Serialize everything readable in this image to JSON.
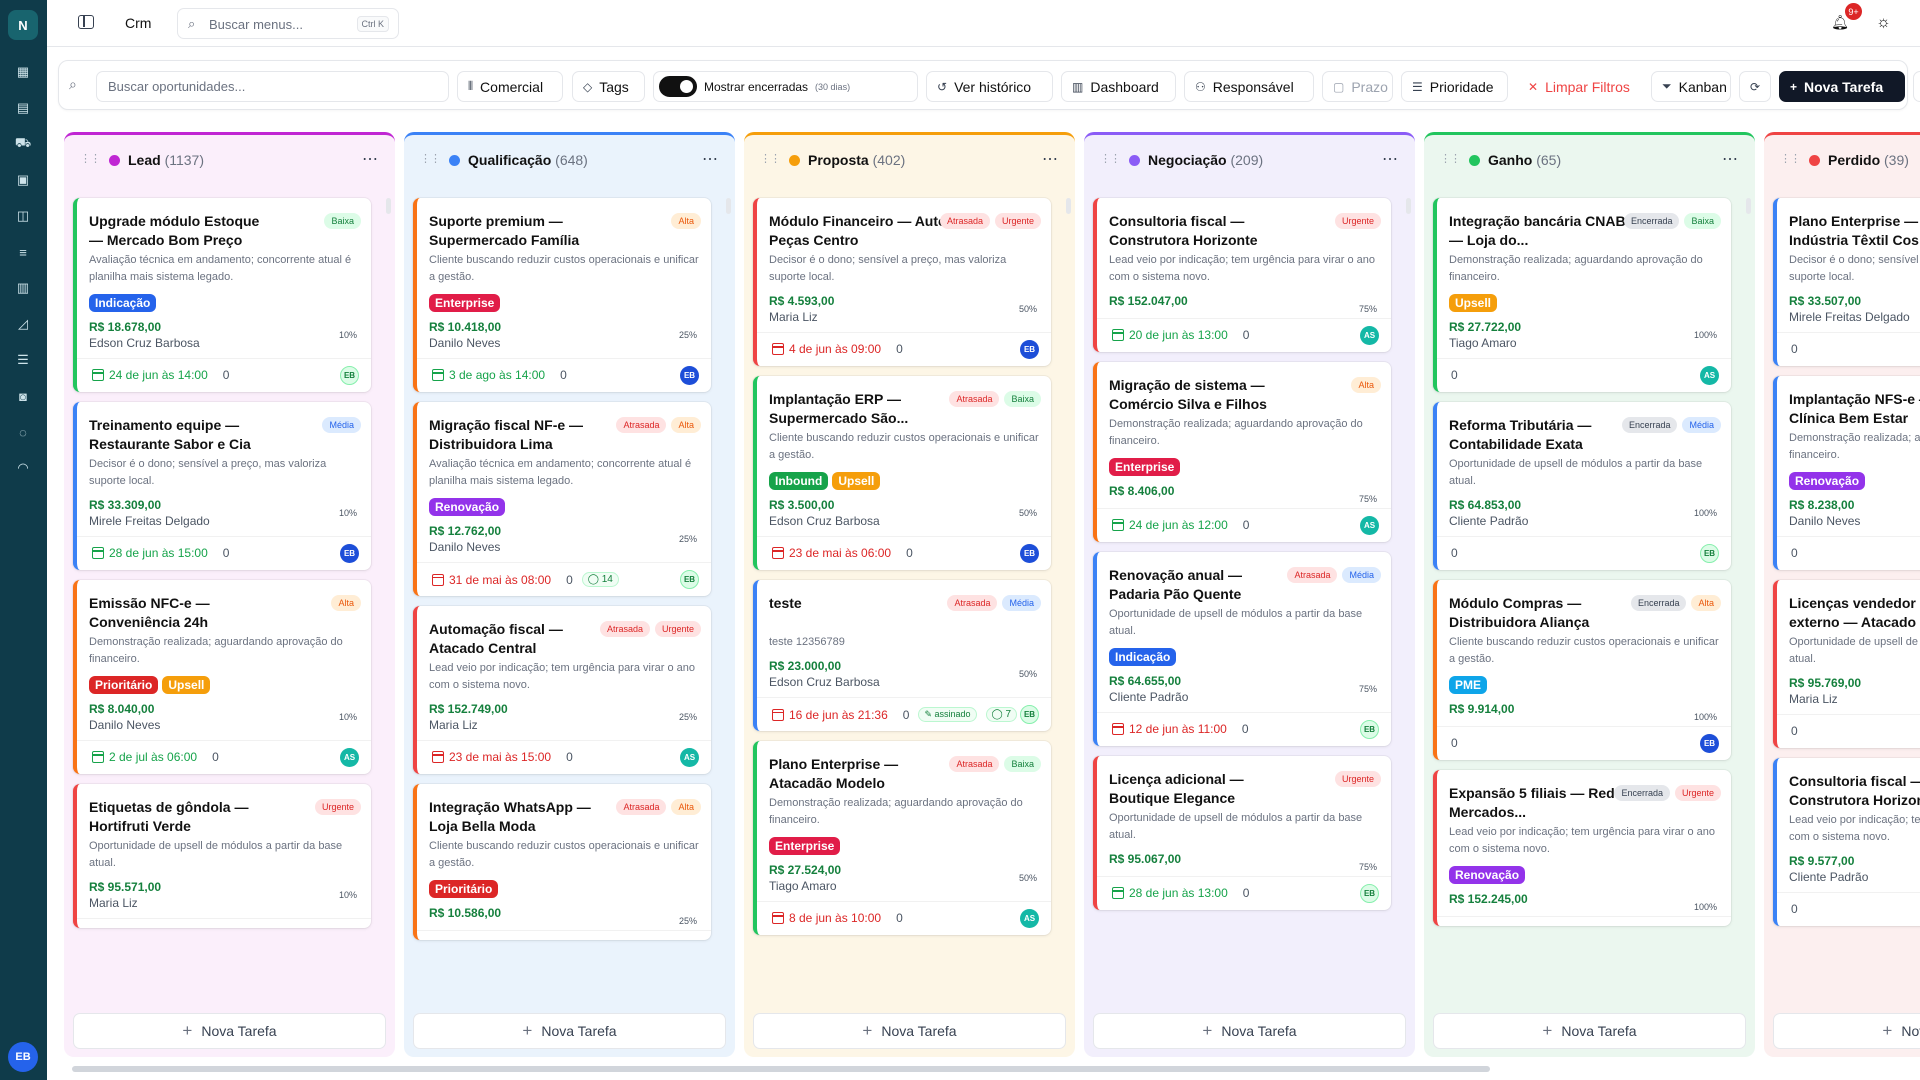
{
  "app": {
    "logo": "N",
    "title": "Crm",
    "avatar": "EB"
  },
  "menu_search": {
    "placeholder": "Buscar menus...",
    "shortcut": "Ctrl K"
  },
  "notifications": {
    "badge": "9+"
  },
  "filters": {
    "search_placeholder": "Buscar oportunidades...",
    "comercial": "Comercial",
    "tags": "Tags",
    "show_closed": "Mostrar encerradas",
    "show_closed_note": "(30 dias)",
    "history": "Ver histórico",
    "dashboard": "Dashboard",
    "owner": "Responsável",
    "deadline": "Prazo",
    "priority": "Prioridade",
    "clear": "Limpar Filtros",
    "view": "Kanban",
    "new_task": "Nova Tarefa"
  },
  "footer_label": "Nova Tarefa",
  "columns": [
    {
      "name": "Lead",
      "count": "(1137)",
      "color": "#c026d3",
      "bg": "#fbeffb",
      "cards": [
        {
          "title": "Upgrade módulo Estoque — Mercado Bom Preço",
          "tags": [
            "Baixa"
          ],
          "desc": "Avaliação técnica em andamento; concorrente atual é planilha mais sistema legado.",
          "badges": [
            "Indicação"
          ],
          "value": "R$ 18.678,00",
          "owner": "Edson Cruz Barbosa",
          "pct": "10%",
          "date": "24 de jun às 14:00",
          "count": "0",
          "avatar": "EB",
          "avatar_style": "green",
          "border": "#22c55e",
          "date_color": "#16a34a"
        },
        {
          "title": "Treinamento equipe — Restaurante Sabor e Cia",
          "tags": [
            "Média"
          ],
          "desc": "Decisor é o dono; sensível a preço, mas valoriza suporte local.",
          "badges": [],
          "value": "R$ 33.309,00",
          "owner": "Mirele Freitas Delgado",
          "pct": "10%",
          "date": "28 de jun às 15:00",
          "count": "0",
          "avatar": "EB",
          "avatar_style": "blue",
          "border": "#3b82f6",
          "date_color": "#16a34a"
        },
        {
          "title": "Emissão NFC-e — Conveniência 24h",
          "tags": [
            "Alta"
          ],
          "desc": "Demonstração realizada; aguardando aprovação do financeiro.",
          "badges": [
            "Prioritário",
            "Upsell"
          ],
          "value": "R$ 8.040,00",
          "owner": "Danilo Neves",
          "pct": "10%",
          "date": "2 de jul às 06:00",
          "count": "0",
          "avatar": "AS",
          "avatar_style": "teal",
          "border": "#f97316",
          "date_color": "#16a34a"
        },
        {
          "title": "Etiquetas de gôndola — Hortifruti Verde",
          "tags": [
            "Urgente"
          ],
          "desc": "Oportunidade de upsell de módulos a partir da base atual.",
          "badges": [],
          "value": "R$ 95.571,00",
          "owner": "Maria Liz",
          "pct": "10%",
          "date": "",
          "count": "",
          "avatar": "",
          "avatar_style": "",
          "border": "#ef4444",
          "date_color": "#16a34a"
        }
      ]
    },
    {
      "name": "Qualificação",
      "count": "(648)",
      "color": "#3b82f6",
      "bg": "#eaf3fc",
      "cards": [
        {
          "title": "Suporte premium — Supermercado Família",
          "tags": [
            "Alta"
          ],
          "desc": "Cliente buscando reduzir custos operacionais e unificar a gestão.",
          "badges": [
            "Enterprise"
          ],
          "value": "R$ 10.418,00",
          "owner": "Danilo Neves",
          "pct": "25%",
          "date": "3 de ago às 14:00",
          "count": "0",
          "avatar": "EB",
          "avatar_style": "blue",
          "border": "#f97316",
          "date_color": "#16a34a"
        },
        {
          "title": "Migração fiscal NF-e — Distribuidora Lima",
          "tags": [
            "Atrasada",
            "Alta"
          ],
          "desc": "Avaliação técnica em andamento; concorrente atual é planilha mais sistema legado.",
          "badges": [
            "Renovação"
          ],
          "value": "R$ 12.762,00",
          "owner": "Danilo Neves",
          "pct": "25%",
          "date": "31 de mai às 08:00",
          "count": "0",
          "wa": "14",
          "avatar": "EB",
          "avatar_style": "green",
          "border": "#f97316",
          "date_color": "#dc2626"
        },
        {
          "title": "Automação fiscal — Atacado Central",
          "tags": [
            "Atrasada",
            "Urgente"
          ],
          "desc": "Lead veio por indicação; tem urgência para virar o ano com o sistema novo.",
          "badges": [],
          "value": "R$ 152.749,00",
          "owner": "Maria Liz",
          "pct": "25%",
          "date": "23 de mai às 15:00",
          "count": "0",
          "avatar": "AS",
          "avatar_style": "teal",
          "border": "#ef4444",
          "date_color": "#dc2626"
        },
        {
          "title": "Integração WhatsApp — Loja Bella Moda",
          "tags": [
            "Atrasada",
            "Alta"
          ],
          "desc": "Cliente buscando reduzir custos operacionais e unificar a gestão.",
          "badges": [
            "Prioritário"
          ],
          "value": "R$ 10.586,00",
          "owner": "",
          "pct": "25%",
          "date": "",
          "count": "",
          "avatar": "",
          "avatar_style": "",
          "border": "#f97316",
          "date_color": "#dc2626"
        }
      ]
    },
    {
      "name": "Proposta",
      "count": "(402)",
      "color": "#f59e0b",
      "bg": "#fdf6e6",
      "cards": [
        {
          "title": "Módulo Financeiro — Auto Peças Centro",
          "tags": [
            "Atrasada",
            "Urgente"
          ],
          "desc": "Decisor é o dono; sensível a preço, mas valoriza suporte local.",
          "badges": [],
          "value": "R$ 4.593,00",
          "owner": "Maria Liz",
          "pct": "50%",
          "date": "4 de jun às 09:00",
          "count": "0",
          "avatar": "EB",
          "avatar_style": "blue",
          "border": "#ef4444",
          "date_color": "#dc2626"
        },
        {
          "title": "Implantação ERP — Supermercado São...",
          "tags": [
            "Atrasada",
            "Baixa"
          ],
          "desc": "Cliente buscando reduzir custos operacionais e unificar a gestão.",
          "badges": [
            "Inbound",
            "Upsell"
          ],
          "value": "R$ 3.500,00",
          "owner": "Edson Cruz Barbosa",
          "pct": "50%",
          "date": "23 de mai às 06:00",
          "count": "0",
          "avatar": "EB",
          "avatar_style": "blue",
          "border": "#22c55e",
          "date_color": "#dc2626"
        },
        {
          "title": "teste",
          "tags": [
            "Atrasada",
            "Média"
          ],
          "desc": "teste 12356789",
          "badges": [],
          "value": "R$ 23.000,00",
          "owner": "Edson Cruz Barbosa",
          "pct": "50%",
          "date": "16 de jun às 21:36",
          "count": "0",
          "assin": "assinado",
          "wa": "7",
          "avatar": "EB",
          "avatar_style": "green",
          "border": "#3b82f6",
          "date_color": "#dc2626"
        },
        {
          "title": "Plano Enterprise — Atacadão Modelo",
          "tags": [
            "Atrasada",
            "Baixa"
          ],
          "desc": "Demonstração realizada; aguardando aprovação do financeiro.",
          "badges": [
            "Enterprise"
          ],
          "value": "R$ 27.524,00",
          "owner": "Tiago Amaro",
          "pct": "50%",
          "date": "8 de jun às 10:00",
          "count": "0",
          "avatar": "AS",
          "avatar_style": "teal",
          "border": "#22c55e",
          "date_color": "#dc2626"
        }
      ]
    },
    {
      "name": "Negociação",
      "count": "(209)",
      "color": "#8b5cf6",
      "bg": "#f2effc",
      "cards": [
        {
          "title": "Consultoria fiscal — Construtora Horizonte",
          "tags": [
            "Urgente"
          ],
          "desc": "Lead veio por indicação; tem urgência para virar o ano com o sistema novo.",
          "badges": [],
          "value": "R$ 152.047,00",
          "owner": "",
          "pct": "75%",
          "date": "20 de jun às 13:00",
          "count": "0",
          "avatar": "AS",
          "avatar_style": "teal",
          "border": "#ef4444",
          "date_color": "#16a34a"
        },
        {
          "title": "Migração de sistema — Comércio Silva e Filhos",
          "tags": [
            "Alta"
          ],
          "desc": "Demonstração realizada; aguardando aprovação do financeiro.",
          "badges": [
            "Enterprise"
          ],
          "value": "R$ 8.406,00",
          "owner": "",
          "pct": "75%",
          "date": "24 de jun às 12:00",
          "count": "0",
          "avatar": "AS",
          "avatar_style": "teal",
          "border": "#f97316",
          "date_color": "#16a34a"
        },
        {
          "title": "Renovação anual — Padaria Pão Quente",
          "tags": [
            "Atrasada",
            "Média"
          ],
          "desc": "Oportunidade de upsell de módulos a partir da base atual.",
          "badges": [
            "Indicação"
          ],
          "value": "R$ 64.655,00",
          "owner": "Cliente Padrão",
          "pct": "75%",
          "date": "12 de jun às 11:00",
          "count": "0",
          "avatar": "EB",
          "avatar_style": "green",
          "border": "#3b82f6",
          "date_color": "#dc2626"
        },
        {
          "title": "Licença adicional — Boutique Elegance",
          "tags": [
            "Urgente"
          ],
          "desc": "Oportunidade de upsell de módulos a partir da base atual.",
          "badges": [],
          "value": "R$ 95.067,00",
          "owner": "",
          "pct": "75%",
          "date": "28 de jun às 13:00",
          "count": "0",
          "avatar": "EB",
          "avatar_style": "green",
          "border": "#ef4444",
          "date_color": "#16a34a"
        }
      ]
    },
    {
      "name": "Ganho",
      "count": "(65)",
      "color": "#22c55e",
      "bg": "#ebf7ef",
      "cards": [
        {
          "title": "Integração bancária CNAB — Loja do...",
          "tags": [
            "Encerrada",
            "Baixa"
          ],
          "desc": "Demonstração realizada; aguardando aprovação do financeiro.",
          "badges": [
            "Upsell"
          ],
          "value": "R$ 27.722,00",
          "owner": "Tiago Amaro",
          "pct": "100%",
          "date": "",
          "count": "0",
          "avatar": "AS",
          "avatar_style": "teal",
          "border": "#22c55e",
          "date_color": "#16a34a"
        },
        {
          "title": "Reforma Tributária — Contabilidade Exata",
          "tags": [
            "Encerrada",
            "Média"
          ],
          "desc": "Oportunidade de upsell de módulos a partir da base atual.",
          "badges": [],
          "value": "R$ 64.853,00",
          "owner": "Cliente Padrão",
          "pct": "100%",
          "date": "",
          "count": "0",
          "avatar": "EB",
          "avatar_style": "green",
          "border": "#3b82f6",
          "date_color": "#16a34a"
        },
        {
          "title": "Módulo Compras — Distribuidora Aliança",
          "tags": [
            "Encerrada",
            "Alta"
          ],
          "desc": "Cliente buscando reduzir custos operacionais e unificar a gestão.",
          "badges": [
            "PME"
          ],
          "value": "R$ 9.914,00",
          "owner": "",
          "pct": "100%",
          "date": "",
          "count": "0",
          "avatar": "EB",
          "avatar_style": "blue",
          "border": "#f97316",
          "date_color": "#16a34a"
        },
        {
          "title": "Expansão 5 filiais — Rede Mercados...",
          "tags": [
            "Encerrada",
            "Urgente"
          ],
          "desc": "Lead veio por indicação; tem urgência para virar o ano com o sistema novo.",
          "badges": [
            "Renovação"
          ],
          "value": "R$ 152.245,00",
          "owner": "",
          "pct": "100%",
          "date": "",
          "count": "",
          "avatar": "",
          "avatar_style": "",
          "border": "#ef4444",
          "date_color": "#16a34a"
        }
      ]
    },
    {
      "name": "Perdido",
      "count": "(39)",
      "color": "#ef4444",
      "bg": "#fcefef",
      "cards": [
        {
          "title": "Plano Enterprise — Indústria Têxtil Cos",
          "tags": [],
          "desc": "Decisor é o dono; sensível a preço, mas valoriza suporte local.",
          "badges": [],
          "value": "R$ 33.507,00",
          "owner": "Mirele Freitas Delgado",
          "pct": "",
          "date": "",
          "count": "0",
          "avatar": "",
          "avatar_style": "",
          "border": "#3b82f6",
          "date_color": "#16a34a"
        },
        {
          "title": "Implantação NFS-e — Clínica Bem Estar",
          "tags": [],
          "desc": "Demonstração realizada; aguardando aprovação do financeiro.",
          "badges": [
            "Renovação"
          ],
          "value": "R$ 8.238,00",
          "owner": "Danilo Neves",
          "pct": "",
          "date": "",
          "count": "0",
          "avatar": "",
          "avatar_style": "",
          "border": "#3b82f6",
          "date_color": "#16a34a"
        },
        {
          "title": "Licenças vendedor externo — Atacado",
          "tags": [],
          "desc": "Oportunidade de upsell de módulos a partir da base atual.",
          "badges": [],
          "value": "R$ 95.769,00",
          "owner": "Maria Liz",
          "pct": "",
          "date": "",
          "count": "0",
          "avatar": "",
          "avatar_style": "",
          "border": "#ef4444",
          "date_color": "#16a34a"
        },
        {
          "title": "Consultoria fiscal — Construtora Horizonte",
          "tags": [],
          "desc": "Lead veio por indicação; tem urgência para virar o ano com o sistema novo.",
          "badges": [],
          "value": "R$ 9.577,00",
          "owner": "Cliente Padrão",
          "pct": "",
          "date": "",
          "count": "0",
          "avatar": "",
          "avatar_style": "",
          "border": "#3b82f6",
          "date_color": "#16a34a"
        }
      ]
    }
  ],
  "icons": {
    "rail": [
      "grid-icon",
      "document-icon",
      "cart-icon",
      "wallet-icon",
      "box-icon",
      "sliders-icon",
      "bar-chart-icon",
      "line-chart-icon",
      "report-icon",
      "bot-icon",
      "chat-icon",
      "headset-icon"
    ]
  }
}
